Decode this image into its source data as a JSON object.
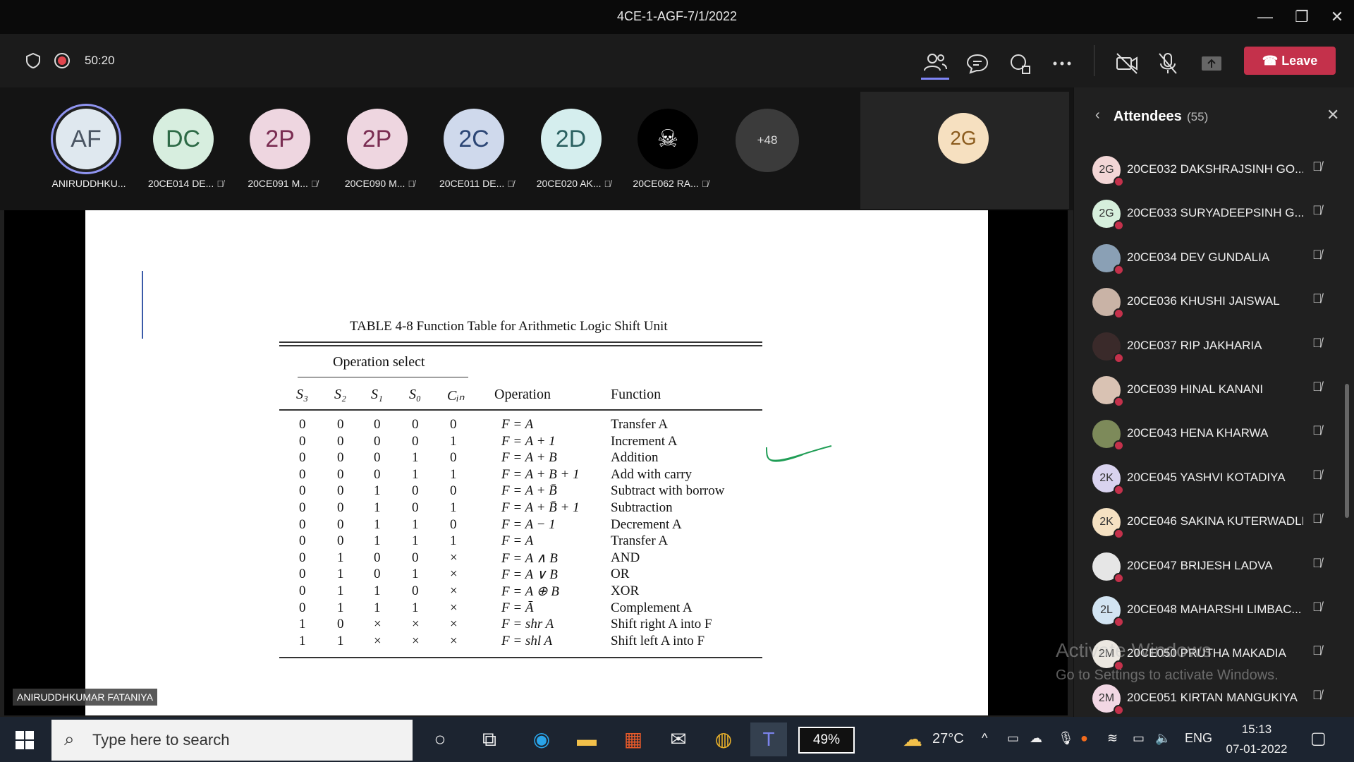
{
  "window": {
    "title": "4CE-1-AGF-7/1/2022",
    "minimize": "—",
    "restore": "❐",
    "close": "✕"
  },
  "toolbar": {
    "timer": "50:20",
    "leave_label": "Leave",
    "icons": [
      "shield-icon",
      "record-icon",
      "people-icon",
      "chat-icon",
      "reactions-icon",
      "more-icon",
      "camera-off-icon",
      "mic-off-icon",
      "share-icon"
    ]
  },
  "participants": [
    {
      "initials": "AF",
      "name": "ANIRUDDHKU...",
      "bg": "#dfe8ef",
      "fg": "#4a5563",
      "ring": true
    },
    {
      "initials": "DC",
      "name": "20CE014 DE...",
      "bg": "#d7eedf",
      "fg": "#2d6a46"
    },
    {
      "initials": "2P",
      "name": "20CE091 M...",
      "bg": "#eed6e0",
      "fg": "#7a2d52"
    },
    {
      "initials": "2P",
      "name": "20CE090 M...",
      "bg": "#eed6e0",
      "fg": "#7a2d52"
    },
    {
      "initials": "2C",
      "name": "20CE011 DE...",
      "bg": "#cfd9ec",
      "fg": "#2c4675"
    },
    {
      "initials": "2D",
      "name": "20CE020 AK...",
      "bg": "#d5eeee",
      "fg": "#2b6161"
    },
    {
      "initials": "",
      "name": "20CE062 RA...",
      "bg": "#000000",
      "fg": "#ffffff"
    }
  ],
  "more_participants": "+48",
  "tile_initials": "2G",
  "stage": {
    "table_title": "TABLE 4-8  Function Table for Arithmetic Logic Shift Unit",
    "op_select": "Operation select",
    "headers": [
      "S₃",
      "S₂",
      "S₁",
      "S₀",
      "Cᵢₙ",
      "Operation",
      "Function"
    ],
    "rows": [
      [
        "0",
        "0",
        "0",
        "0",
        "0",
        "F = A",
        "Transfer A"
      ],
      [
        "0",
        "0",
        "0",
        "0",
        "1",
        "F = A + 1",
        "Increment A"
      ],
      [
        "0",
        "0",
        "0",
        "1",
        "0",
        "F = A + B",
        "Addition"
      ],
      [
        "0",
        "0",
        "0",
        "1",
        "1",
        "F = A + B + 1",
        "Add with carry"
      ],
      [
        "0",
        "0",
        "1",
        "0",
        "0",
        "F = A + B̄",
        "Subtract with borrow"
      ],
      [
        "0",
        "0",
        "1",
        "0",
        "1",
        "F = A + B̄ + 1",
        "Subtraction"
      ],
      [
        "0",
        "0",
        "1",
        "1",
        "0",
        "F = A − 1",
        "Decrement A"
      ],
      [
        "0",
        "0",
        "1",
        "1",
        "1",
        "F = A",
        "Transfer A"
      ],
      [
        "0",
        "1",
        "0",
        "0",
        "×",
        "F = A ∧ B",
        "AND"
      ],
      [
        "0",
        "1",
        "0",
        "1",
        "×",
        "F = A ∨ B",
        "OR"
      ],
      [
        "0",
        "1",
        "1",
        "0",
        "×",
        "F = A ⊕ B",
        "XOR"
      ],
      [
        "0",
        "1",
        "1",
        "1",
        "×",
        "F = Ā",
        "Complement A"
      ],
      [
        "1",
        "0",
        "×",
        "×",
        "×",
        "F = shr A",
        "Shift right A into F"
      ],
      [
        "1",
        "1",
        "×",
        "×",
        "×",
        "F = shl A",
        "Shift left A into F"
      ]
    ],
    "presenter": "ANIRUDDHKUMAR FATANIYA"
  },
  "attendees": {
    "title": "Attendees",
    "count": "(55)",
    "list": [
      {
        "initials": "2G",
        "name": "20CE032 DAKSHRAJSINH GO...",
        "bg": "#f3d6d6"
      },
      {
        "initials": "2G",
        "name": "20CE033 SURYADEEPSINH G...",
        "bg": "#d6efdc"
      },
      {
        "initials": "",
        "name": "20CE034 DEV GUNDALIA",
        "bg": "#8aa0b5"
      },
      {
        "initials": "",
        "name": "20CE036 KHUSHI JAISWAL",
        "bg": "#c9b3a6"
      },
      {
        "initials": "",
        "name": "20CE037 RIP JAKHARIA",
        "bg": "#3a2a2a"
      },
      {
        "initials": "",
        "name": "20CE039 HINAL KANANI",
        "bg": "#d9c2b3"
      },
      {
        "initials": "",
        "name": "20CE043 HENA KHARWA",
        "bg": "#7d8a5a"
      },
      {
        "initials": "2K",
        "name": "20CE045 YASHVI KOTADIYA",
        "bg": "#d9d3ef"
      },
      {
        "initials": "2K",
        "name": "20CE046 SAKINA KUTERWADLI",
        "bg": "#f5e1c2"
      },
      {
        "initials": "",
        "name": "20CE047 BRIJESH LADVA",
        "bg": "#e6e6e6"
      },
      {
        "initials": "2L",
        "name": "20CE048 MAHARSHI LIMBAC...",
        "bg": "#d2e4f2"
      },
      {
        "initials": "2M",
        "name": "20CE050 PRUTHA MAKADIA",
        "bg": "#ece8e1"
      },
      {
        "initials": "2M",
        "name": "20CE051 KIRTAN MANGUKIYA",
        "bg": "#f2d7e4"
      }
    ]
  },
  "watermark": {
    "line1": "Activate Windows",
    "line2": "Go to Settings to activate Windows."
  },
  "taskbar": {
    "search_placeholder": "Type here to search",
    "battery": "49%",
    "temperature": "27°C",
    "language": "ENG",
    "time": "15:13",
    "date": "07-01-2022"
  }
}
